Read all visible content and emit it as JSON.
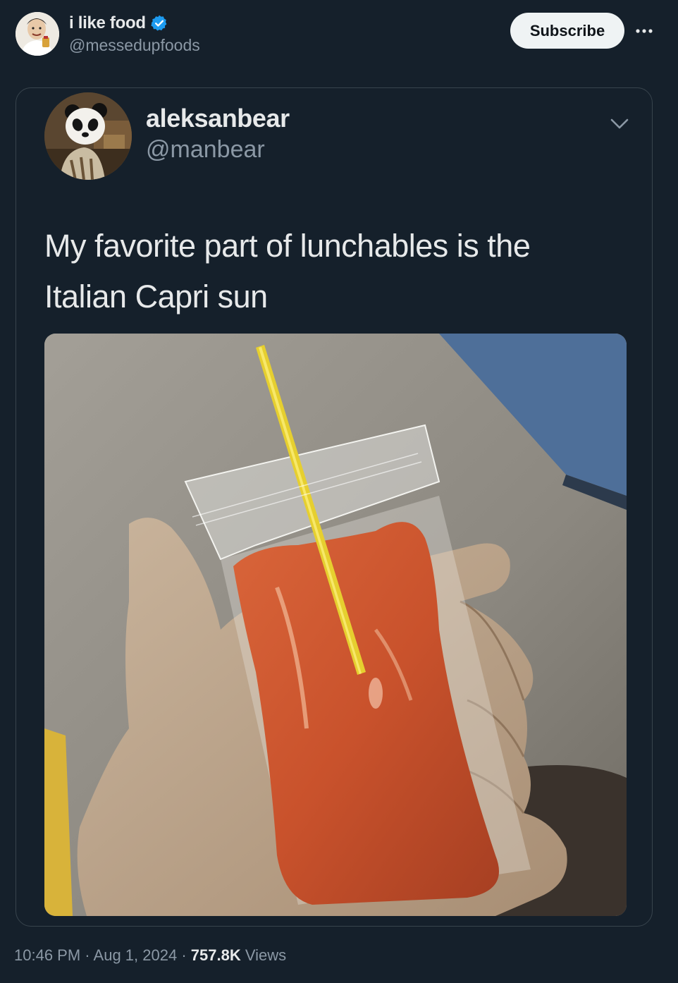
{
  "author": {
    "display_name": "i like food",
    "handle": "@messedupfoods",
    "verified": true,
    "verified_color": "#1d9bf0"
  },
  "actions": {
    "subscribe_label": "Subscribe",
    "more_icon": "more-horizontal-icon"
  },
  "quoted_tweet": {
    "display_name": "aleksanbear",
    "handle": "@manbear",
    "text_line1": "My favorite part of lunchables is the",
    "text_line2": "Italian Capri sun",
    "menu_icon": "chevron-down-icon"
  },
  "meta": {
    "time": "10:46 PM",
    "separator": "·",
    "date": "Aug 1, 2024",
    "views_count": "757.8K",
    "views_label": "Views"
  },
  "colors": {
    "background": "#15202b",
    "text_primary": "#e7e9ea",
    "text_secondary": "#8b98a5",
    "border": "#38444d"
  }
}
